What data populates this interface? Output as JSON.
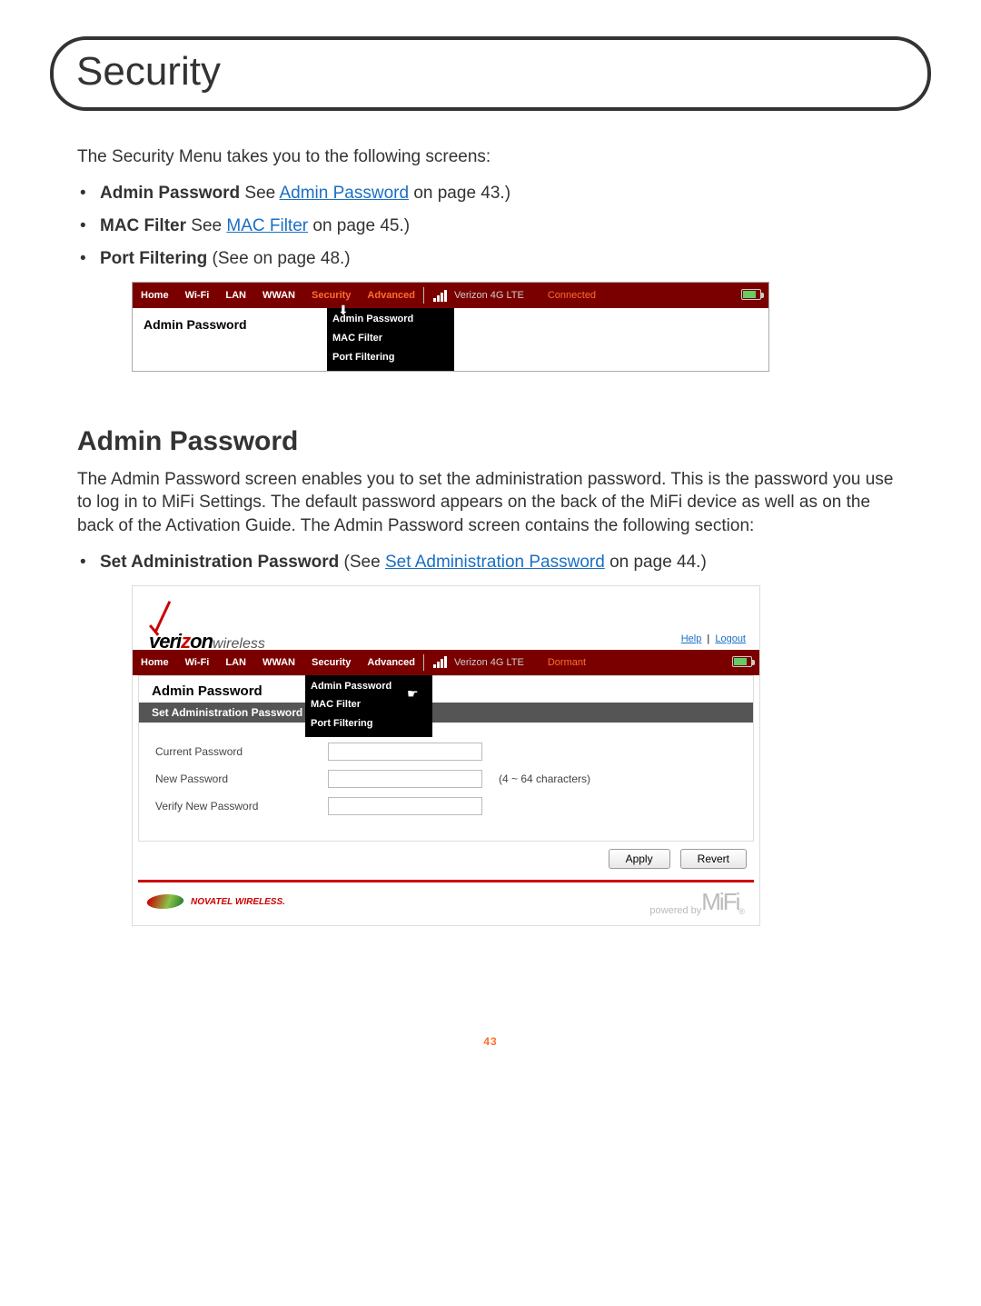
{
  "page_number": "43",
  "title": "Security",
  "intro": "The Security Menu takes you to the following screens:",
  "bullets": [
    {
      "bold": "Admin Password",
      "mid": " See ",
      "link": "Admin Password",
      "tail": " on page 43.)"
    },
    {
      "bold": "MAC Filter",
      "mid": " See ",
      "link": "MAC Filter",
      "tail": " on page 45.)"
    },
    {
      "bold": "Port Filtering",
      "mid": " (See  on page 48.)",
      "link": "",
      "tail": ""
    }
  ],
  "section_heading": "Admin Password",
  "section_para": "The Admin Password screen enables you to set the administration password. This is the password you use to log in to MiFi Settings. The default password appears on the back of the MiFi device as well as on the back of the Activation Guide. The Admin Password screen contains the following section:",
  "sub_bullet": {
    "bold": "Set Administration Password",
    "mid": " (See ",
    "link": "Set Administration Password",
    "tail": " on page 44.)"
  },
  "shot1": {
    "nav": [
      "Home",
      "Wi-Fi",
      "LAN",
      "WWAN",
      "Security",
      "Advanced"
    ],
    "carrier": "Verizon  4G LTE",
    "conn": "Connected",
    "panel_title": "Admin Password",
    "menu": [
      "Admin Password",
      "MAC Filter",
      "Port Filtering"
    ]
  },
  "shot2": {
    "help": "Help",
    "logout": "Logout",
    "brand": "verizon",
    "brand_suffix": "wireless",
    "nav": [
      "Home",
      "Wi-Fi",
      "LAN",
      "WWAN",
      "Security",
      "Advanced"
    ],
    "carrier": "Verizon  4G LTE",
    "conn": "Dormant",
    "panel_title": "Admin Password",
    "menu": [
      "Admin Password",
      "MAC Filter",
      "Port Filtering"
    ],
    "subhead": "Set Administration Password",
    "labels": {
      "current": "Current Password",
      "new": "New Password",
      "verify": "Verify New Password",
      "hint": "(4 ~ 64 characters)"
    },
    "buttons": {
      "apply": "Apply",
      "revert": "Revert"
    },
    "footer_brand": "NOVATEL WIRELESS.",
    "powered": "powered by",
    "mifi": "MiFi"
  }
}
